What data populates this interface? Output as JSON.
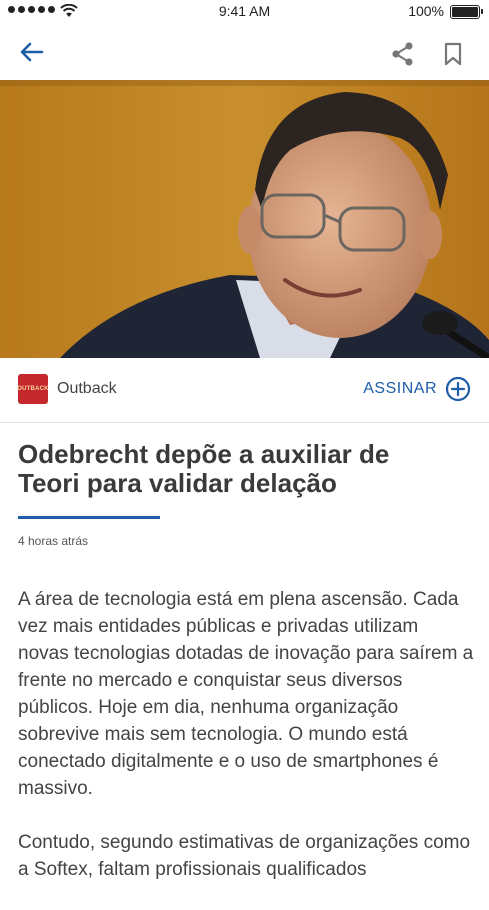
{
  "status_bar": {
    "time": "9:41 AM",
    "battery": "100%"
  },
  "nav": {
    "back_icon": "arrow-left-icon",
    "share_icon": "share-icon",
    "bookmark_icon": "bookmark-icon"
  },
  "source": {
    "name": "Outback",
    "logo_text": "OUTBACK",
    "subscribe_label": "ASSINAR",
    "accent": "#1d5ea8"
  },
  "article": {
    "title": "Odebrecht depõe a auxiliar de Teori para validar delação",
    "time_ago": "4 horas atrás",
    "paragraphs": [
      "A área de tecnologia está em plena ascensão. Cada vez mais entidades públicas e privadas utilizam novas tecnologias dotadas de inovação para saírem a frente no mercado e conquistar seus diversos públicos. Hoje em dia, nenhuma organização sobrevive mais sem tecnologia. O mundo está conectado digitalmente e o uso de smartphones é massivo.",
      "Contudo, segundo estimativas de organizações como a Softex, faltam profissionais qualificados"
    ]
  }
}
